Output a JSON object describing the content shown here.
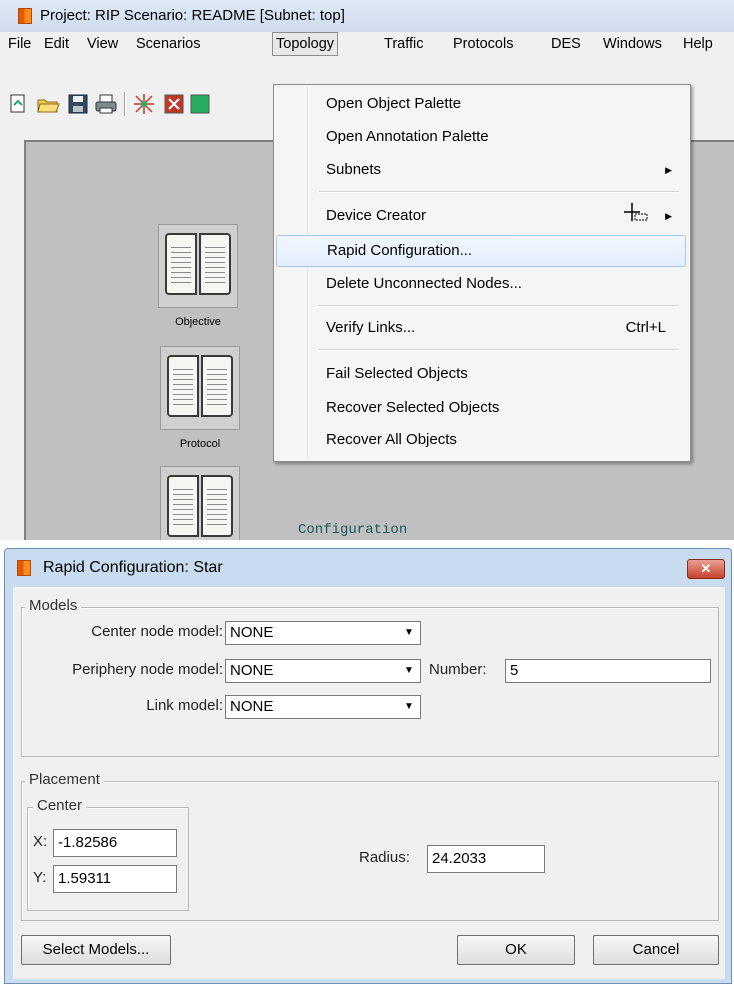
{
  "main_window": {
    "title": "Project: RIP Scenario: README  [Subnet: top]",
    "menu": [
      "File",
      "Edit",
      "View",
      "Scenarios",
      "Topology",
      "Traffic",
      "Protocols",
      "DES",
      "Windows",
      "Help"
    ],
    "open_menu": "Topology"
  },
  "topology_menu": {
    "items": [
      {
        "label": "Open Object Palette",
        "shortcut": "",
        "submenu": false
      },
      {
        "label": "Open Annotation Palette",
        "shortcut": "",
        "submenu": false
      },
      {
        "label": "Subnets",
        "shortcut": "",
        "submenu": true
      },
      {
        "label": "Device Creator",
        "shortcut": "",
        "submenu": true
      },
      {
        "label": "Rapid Configuration...",
        "shortcut": "",
        "submenu": false,
        "highlighted": true
      },
      {
        "label": "Delete Unconnected Nodes...",
        "shortcut": "",
        "submenu": false
      },
      {
        "label": "Verify Links...",
        "shortcut": "Ctrl+L",
        "submenu": false
      },
      {
        "label": "Fail Selected Objects",
        "shortcut": "",
        "submenu": false
      },
      {
        "label": "Recover Selected Objects",
        "shortcut": "",
        "submenu": false
      },
      {
        "label": "Recover All Objects",
        "shortcut": "",
        "submenu": false
      }
    ]
  },
  "workspace": {
    "nodes": [
      "Objective",
      "Protocol",
      ""
    ],
    "annotation": "Configuration"
  },
  "dialog": {
    "title": "Rapid Configuration: Star",
    "close_icon": "close-icon",
    "models": {
      "group_label": "Models",
      "center_label": "Center node model:",
      "center_value": "NONE",
      "periphery_label": "Periphery node model:",
      "periphery_value": "NONE",
      "number_label": "Number:",
      "number_value": "5",
      "link_label": "Link model:",
      "link_value": "NONE"
    },
    "placement": {
      "group_label": "Placement",
      "center_group_label": "Center",
      "x_label": "X:",
      "x_value": "-1.82586",
      "y_label": "Y:",
      "y_value": "1.59311",
      "radius_label": "Radius:",
      "radius_value": "24.2033"
    },
    "buttons": {
      "select_models": "Select Models...",
      "ok": "OK",
      "cancel": "Cancel"
    }
  },
  "colors": {
    "title_bar": "#cfdcee",
    "canvas": "#c0c0c0",
    "menu_highlight": "#e3eefc",
    "dialog_frame": "#c9dbef",
    "close_button": "#c8402a"
  }
}
